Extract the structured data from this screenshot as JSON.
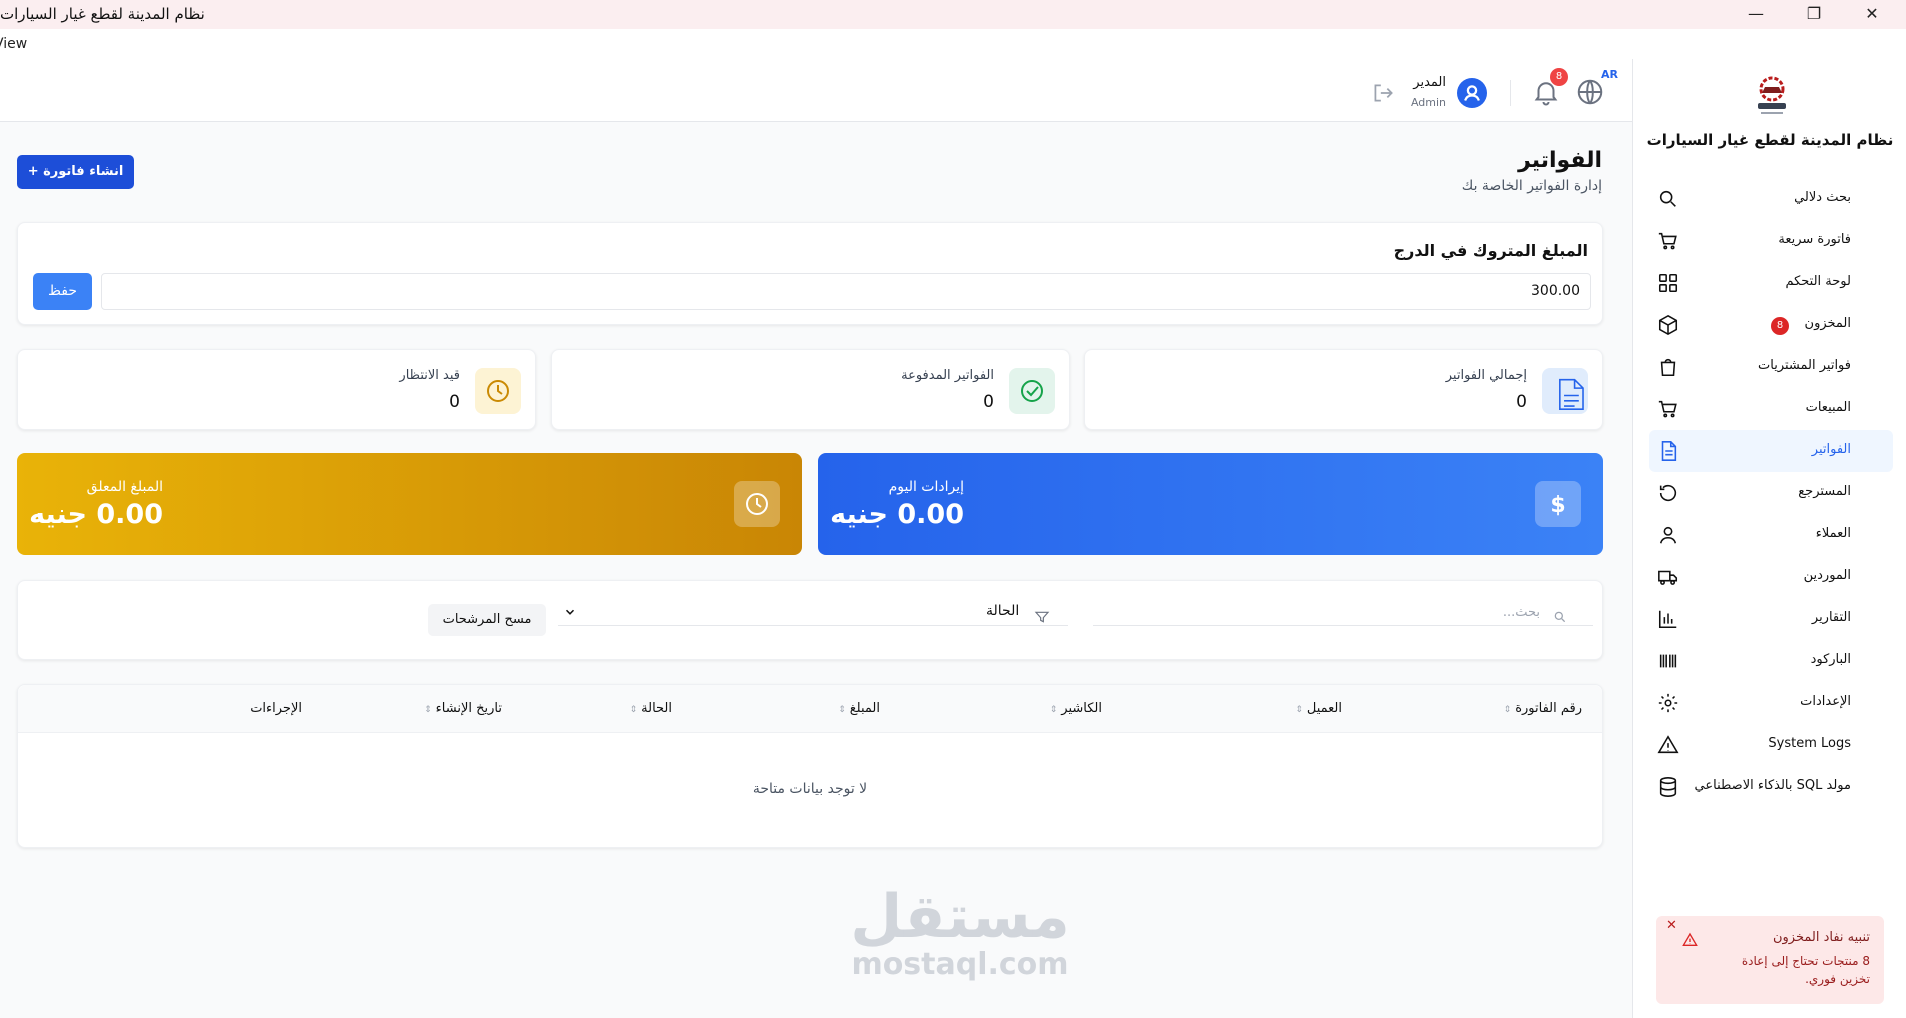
{
  "window": {
    "title": "نظام المدينة لقطع غيار السيارات",
    "minimize": "—",
    "restore": "❐",
    "close": "✕",
    "menu_view": "View"
  },
  "header": {
    "lang": "AR",
    "notifications_count": "8",
    "user_name": "المدير",
    "user_role": "Admin"
  },
  "sidebar": {
    "app_name": "نظام المدينة لقطع غيار السيارات",
    "items": [
      {
        "label": "بحث دلالي",
        "icon": "search-icon"
      },
      {
        "label": "فاتورة سريعة",
        "icon": "cart-icon"
      },
      {
        "label": "لوحة التحكم",
        "icon": "dashboard-icon"
      },
      {
        "label": "المخزون",
        "icon": "box-icon",
        "badge": "8"
      },
      {
        "label": "فواتير المشتريات",
        "icon": "bag-icon"
      },
      {
        "label": "المبيعات",
        "icon": "cart-icon"
      },
      {
        "label": "الفواتير",
        "icon": "file-icon"
      },
      {
        "label": "المسترجع",
        "icon": "return-icon"
      },
      {
        "label": "العملاء",
        "icon": "user-icon"
      },
      {
        "label": "الموردين",
        "icon": "truck-icon"
      },
      {
        "label": "التقارير",
        "icon": "bar-chart-icon"
      },
      {
        "label": "الباركود",
        "icon": "barcode-icon"
      },
      {
        "label": "الإعدادات",
        "icon": "gear-icon"
      },
      {
        "label": "System Logs",
        "icon": "warning-icon"
      },
      {
        "label": "مولد SQL بالذكاء الاصطناعي",
        "icon": "database-icon"
      }
    ]
  },
  "page": {
    "title": "الفواتير",
    "subtitle": "إدارة الفواتير الخاصة بك",
    "create_label": "انشاء فاتورة  +"
  },
  "drawer": {
    "label": "المبلغ المتروك في الدرج",
    "value": "300.00",
    "save_label": "حفظ"
  },
  "stats": {
    "total_label": "إجمالي الفواتير",
    "total_value": "0",
    "paid_label": "الفواتير المدفوعة",
    "paid_value": "0",
    "pending_label": "قيد الانتظار",
    "pending_value": "0"
  },
  "revenue": {
    "today_label": "إيرادات اليوم",
    "today_value": "0.00 جنيه",
    "outstanding_label": "المبلغ المعلق",
    "outstanding_value": "0.00 جنيه"
  },
  "filters": {
    "search_placeholder": "بحث...",
    "status_label": "الحالة",
    "clear_label": "مسح المرشحات"
  },
  "table": {
    "columns": [
      "رقم الفاتورة",
      "العميل",
      "الكاشير",
      "المبلغ",
      "الحالة",
      "تاريخ الإنشاء",
      "الإجراءات"
    ],
    "sort_glyph": "⇕",
    "empty": "لا توجد بيانات متاحة"
  },
  "toast": {
    "title": "تنبيه نفاد المخزون",
    "message": "8 منتجات تحتاج إلى إعادة تخزين فوري.",
    "close": "✕"
  },
  "watermark": {
    "ar": "مستقل",
    "en": "mostaql.com"
  },
  "colors": {
    "accent": "#2563eb",
    "danger": "#ef4444",
    "gold_from": "#e9b308",
    "gold_to": "#c98605"
  }
}
